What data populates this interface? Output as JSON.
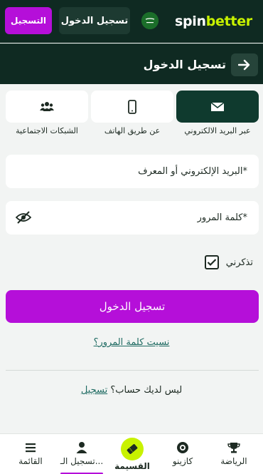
{
  "topbar": {
    "logo_spin": "spin",
    "logo_better": "better",
    "login_label": "تسجيل الدخول",
    "register_label": "التسجيل"
  },
  "header": {
    "title": "تسجيل الدخول",
    "back_icon": "arrow-right-icon"
  },
  "tabs": [
    {
      "label": "عبر البريد الالكتروني",
      "icon": "envelope-icon",
      "active": true
    },
    {
      "label": "عن طريق الهاتف",
      "icon": "phone-icon",
      "active": false
    },
    {
      "label": "الشبكات الاجتماعية",
      "icon": "users-icon",
      "active": false
    }
  ],
  "form": {
    "email_label": "البريد الإلكتروني أو المعرف*",
    "password_label": "كلمة المرور*",
    "remember_label": "تذكرني",
    "remember_checked": true,
    "submit_label": "تسجيل الدخول",
    "forgot_label": "نسيت كلمة المرور؟",
    "no_account_text": "ليس لديك حساب؟",
    "register_link": "تسجيل"
  },
  "bottom_nav": [
    {
      "label": "الرياضة",
      "icon": "trophy-icon"
    },
    {
      "label": "كازينو",
      "icon": "casino-chip-icon"
    },
    {
      "label": "القسيمة",
      "icon": "ticket-icon"
    },
    {
      "label": "تسجيل الـ...",
      "icon": "user-icon",
      "active": true
    },
    {
      "label": "القائمة",
      "icon": "menu-icon"
    }
  ],
  "colors": {
    "brand_dark": "#0f2a22",
    "accent_purple": "#b50fd9",
    "accent_lime": "#c8f200",
    "link": "#1f6b62"
  }
}
